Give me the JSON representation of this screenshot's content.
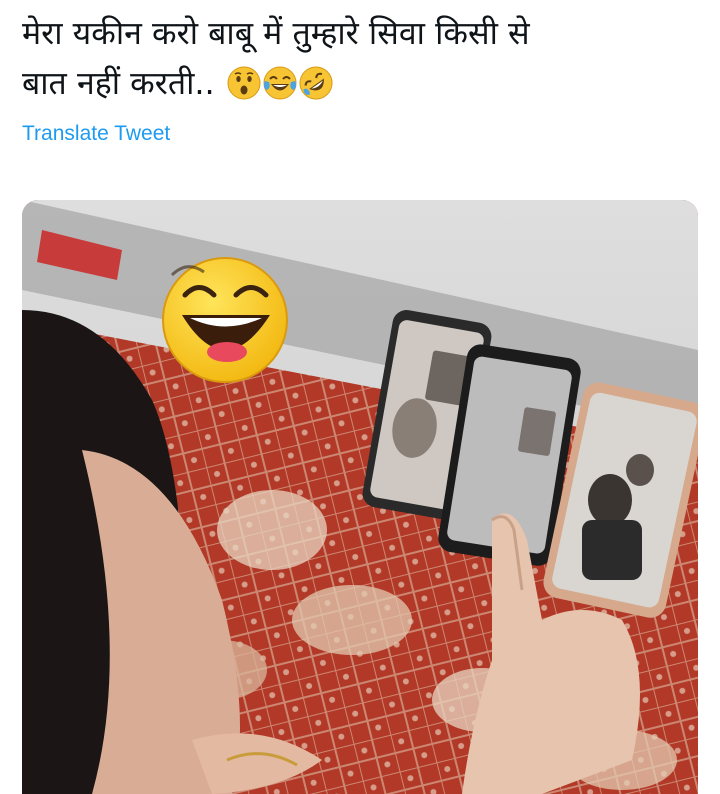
{
  "tweet": {
    "text_line1": "मेरा यकीन करो बाबू में तुम्हारे सिवा किसी से",
    "text_line2": "बात नहीं करती..",
    "emojis": [
      "hushed-face-icon",
      "face-with-tears-of-joy-icon",
      "rolling-on-floor-laughing-icon"
    ],
    "translate_label": "Translate Tweet"
  },
  "media": {
    "description_icon": "laughing-emoji-sticker-icon"
  },
  "colors": {
    "link": "#1d9bf0",
    "text": "#0f1419",
    "bedsheet": "#b9412d"
  }
}
